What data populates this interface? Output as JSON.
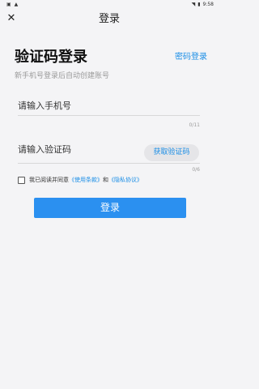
{
  "status_bar": {
    "left_icons": [
      "notification-icon",
      "a-icon"
    ],
    "wifi_icon": "wifi-icon",
    "battery_icon": "battery-icon",
    "time": "9:58"
  },
  "header": {
    "close_icon": "close-icon",
    "title": "登录"
  },
  "main": {
    "heading": "验证码登录",
    "password_login_link": "密码登录",
    "subtitle": "新手机号登录后自动创建账号",
    "phone_field": {
      "placeholder": "请输入手机号",
      "value": "",
      "counter": "0/11"
    },
    "code_field": {
      "placeholder": "请输入验证码",
      "value": "",
      "counter": "0/6"
    },
    "get_code_button": "获取验证码",
    "agreement": {
      "prefix": "我已阅读并同意",
      "terms": "《使用条款》",
      "conjunction": "和",
      "privacy": "《隐私协议》",
      "checked": false
    },
    "login_button": "登录"
  },
  "colors": {
    "accent": "#1b8ee6",
    "button": "#2b90f0",
    "background": "#f4f4f6"
  }
}
